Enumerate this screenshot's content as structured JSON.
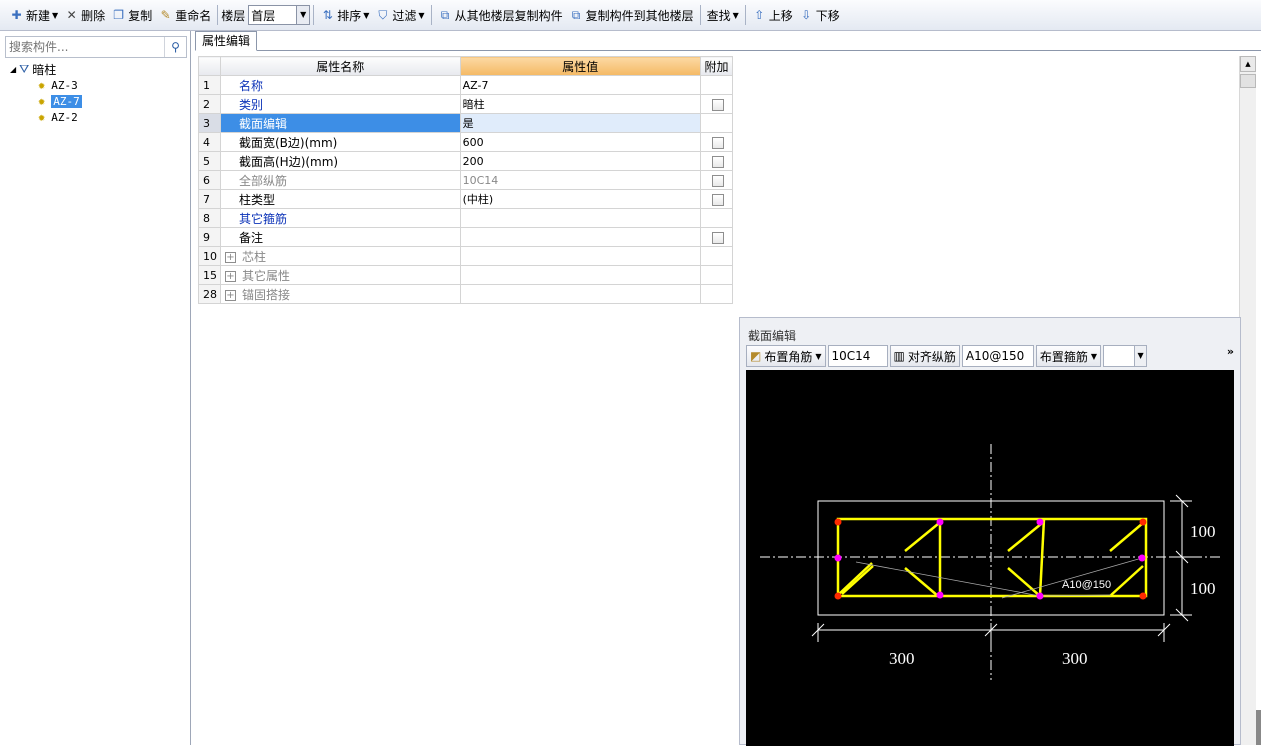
{
  "toolbar": {
    "new": "新建",
    "delete": "删除",
    "copy": "复制",
    "rename": "重命名",
    "floor_label": "楼层",
    "floor_value": "首层",
    "sort": "排序",
    "filter": "过滤",
    "copy_from_floor": "从其他楼层复制构件",
    "copy_to_floor": "复制构件到其他楼层",
    "find": "查找",
    "move_up": "上移",
    "move_down": "下移"
  },
  "search": {
    "placeholder": "搜索构件..."
  },
  "tree": {
    "root": "暗柱",
    "items": [
      "AZ-3",
      "AZ-7",
      "AZ-2"
    ],
    "selected_index": 1
  },
  "tab": "属性编辑",
  "grid": {
    "headers": [
      "属性名称",
      "属性值",
      "附加"
    ],
    "rows": [
      {
        "no": "1",
        "name": "名称",
        "value": "AZ-7",
        "style": "blue",
        "check": false
      },
      {
        "no": "2",
        "name": "类别",
        "value": "暗柱",
        "style": "blue",
        "check": true
      },
      {
        "no": "3",
        "name": "截面编辑",
        "value": "是",
        "style": "blue",
        "check": false,
        "selected": true
      },
      {
        "no": "4",
        "name": "截面宽(B边)(mm)",
        "value": "600",
        "style": "normal",
        "check": true
      },
      {
        "no": "5",
        "name": "截面高(H边)(mm)",
        "value": "200",
        "style": "normal",
        "check": true
      },
      {
        "no": "6",
        "name": "全部纵筋",
        "value": "10C14",
        "style": "gray",
        "check": true
      },
      {
        "no": "7",
        "name": "柱类型",
        "value": "(中柱)",
        "style": "normal",
        "check": true
      },
      {
        "no": "8",
        "name": "其它箍筋",
        "value": "",
        "style": "blue",
        "check": false
      },
      {
        "no": "9",
        "name": "备注",
        "value": "",
        "style": "normal",
        "check": true
      },
      {
        "no": "10",
        "name": "芯柱",
        "value": "",
        "style": "gray",
        "check": false,
        "expand": true
      },
      {
        "no": "15",
        "name": "其它属性",
        "value": "",
        "style": "gray",
        "check": false,
        "expand": true
      },
      {
        "no": "28",
        "name": "锚固搭接",
        "value": "",
        "style": "gray",
        "check": false,
        "expand": true
      }
    ]
  },
  "section_editor": {
    "title": "截面编辑",
    "corner_bar_btn": "布置角筋",
    "corner_bar_value": "10C14",
    "align_btn": "对齐纵筋",
    "stirrup_value": "A10@150",
    "stirrup_btn": "布置箍筋",
    "drawing": {
      "dim_right_top": "100",
      "dim_right_bottom": "100",
      "dim_bottom_left": "300",
      "dim_bottom_right": "300",
      "stirrup_label": "A10@150"
    }
  },
  "colors": {
    "selected_row": "#3d8ee6",
    "active_header": "#f4b964",
    "rebar_line": "#ffff00",
    "corner_bar": "#ff2a00",
    "side_bar": "#ff00ff"
  }
}
